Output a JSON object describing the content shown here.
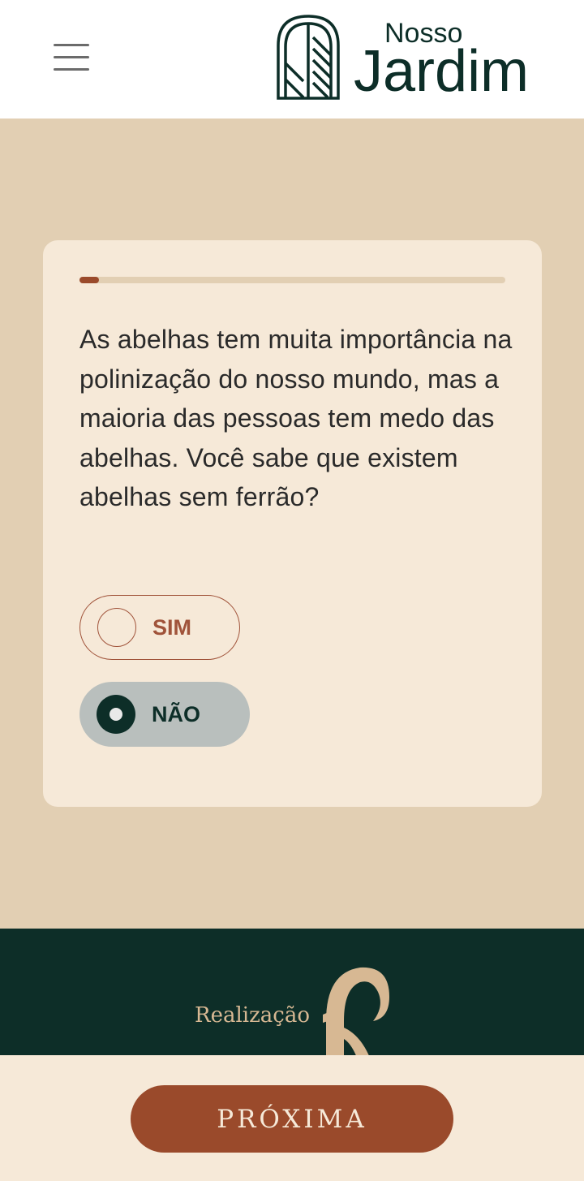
{
  "header": {
    "menu_icon": "hamburger-menu-icon",
    "logo_text_small": "Nosso",
    "logo_text_large": "Jardim"
  },
  "quiz": {
    "progress": 0.045,
    "question": "As abelhas tem muita importância na polinização do nosso mundo, mas a maioria das pessoas tem medo das abelhas. Você sabe que existem abelhas sem ferrão?",
    "options": [
      {
        "label": "SIM",
        "selected": false
      },
      {
        "label": "NÃO",
        "selected": true
      }
    ]
  },
  "footer": {
    "realizacao_label": "Realização"
  },
  "bottom": {
    "next_label": "PRÓXIMA"
  },
  "colors": {
    "accent": "#9a4a2b",
    "dark_green": "#0d2e28",
    "sand": "#e2cfb3",
    "cream": "#f6e9d8"
  }
}
